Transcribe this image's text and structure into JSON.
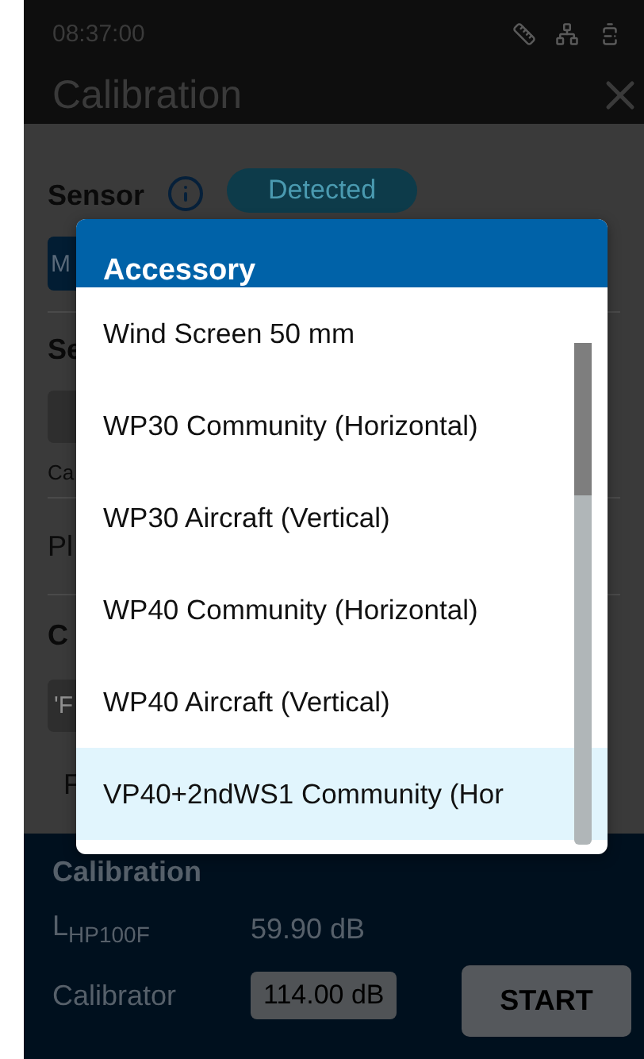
{
  "status_bar": {
    "time": "08:37:00"
  },
  "header": {
    "title": "Calibration"
  },
  "background": {
    "sensor_label": "Sensor",
    "sensor_status": "Detected",
    "mode_button": "M",
    "section_label": "Se",
    "caption": "Ca",
    "row_label": "Pl",
    "section_2_label": "C",
    "field_value": "'F",
    "row_2_label": "F"
  },
  "dialog": {
    "title": "Accessory",
    "items": [
      {
        "label": "Wind Screen 50 mm",
        "selected": false
      },
      {
        "label": "WP30 Community (Horizontal)",
        "selected": false
      },
      {
        "label": "WP30 Aircraft (Vertical)",
        "selected": false
      },
      {
        "label": "WP40 Community (Horizontal)",
        "selected": false
      },
      {
        "label": "WP40 Aircraft (Vertical)",
        "selected": false
      },
      {
        "label": "VP40+2ndWS1 Community (Hor",
        "selected": true
      }
    ]
  },
  "calibration": {
    "title": "Calibration",
    "rows": [
      {
        "kind": "reading",
        "label": "L$_{HP100F}$",
        "value": "59.90 dB"
      },
      {
        "kind": "field",
        "label": "Calibrator",
        "value": "114.00 dB"
      }
    ],
    "start_button": "START"
  }
}
